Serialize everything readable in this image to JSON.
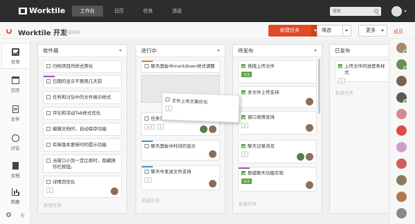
{
  "app": {
    "logo": "Worktile",
    "nav": [
      {
        "label": "工作台",
        "active": true
      },
      {
        "label": "日历",
        "active": false
      },
      {
        "label": "任务",
        "active": false
      },
      {
        "label": "消息",
        "active": false
      }
    ],
    "search": {
      "placeholder": "搜索"
    }
  },
  "project": {
    "title": "Worktile 开发",
    "subtitle": "喜成科技",
    "new_task": "新建任务",
    "filter": "筛选",
    "more": "更多",
    "members_label": "成员"
  },
  "sidebar": {
    "items": [
      {
        "label": "任务",
        "icon": "checkbox-icon",
        "active": true
      },
      {
        "label": "日历",
        "icon": "calendar-icon",
        "active": false
      },
      {
        "label": "文件",
        "icon": "file-icon",
        "active": false
      },
      {
        "label": "讨论",
        "icon": "discussion-icon",
        "active": false
      },
      {
        "label": "文档",
        "icon": "document-icon",
        "active": false
      },
      {
        "label": "简报",
        "icon": "report-icon",
        "active": false
      }
    ],
    "collapse": "折"
  },
  "lists": [
    {
      "title": "收件箱",
      "add_task": "新建任务",
      "cards": [
        {
          "title": "归档项目的样式美化",
          "done": false
        },
        {
          "title": "日期的显示不要用几天前",
          "done": false,
          "stripe": "#9b59b6"
        },
        {
          "title": "任务和讨论中的文件展示样式",
          "done": false
        },
        {
          "title": "评论和活动Tab样式优化",
          "done": false
        },
        {
          "title": "编辑文档时，自动保存功能",
          "done": false
        },
        {
          "title": "有新版本更新时的提示功能",
          "done": false
        },
        {
          "title": "当窗口小到一定比例时，隐藏操作栏按钮。",
          "done": false
        },
        {
          "title": "详情页优化",
          "done": false,
          "badges": [
            "1"
          ]
        }
      ]
    },
    {
      "title": "进行中",
      "add_task": "新建任务",
      "cards": [
        {
          "title": "聊天面板中markdown样式调整",
          "done": false,
          "stripe": "#e67e22"
        },
        {
          "title": "任务菜单中",
          "done": false,
          "badges": [
            "1/2",
            "1"
          ]
        },
        {
          "title": "聊天面板中时间的显示",
          "done": false,
          "stripe": "#3498db"
        },
        {
          "title": "聊天中发送文件支持",
          "done": false,
          "stripe": "#3498db",
          "badges": [
            "1"
          ]
        }
      ],
      "dragging": {
        "title": "文件上传文案优化",
        "badges": [
          "1"
        ]
      }
    },
    {
      "title": "待发布",
      "add_task": "新建任务",
      "cards": [
        {
          "title": "拖拽上传文件",
          "done": true,
          "badges": [
            "3/3"
          ]
        },
        {
          "title": "多文件上传支持",
          "done": true
        },
        {
          "title": "窗口表情支持",
          "done": true,
          "badges": [
            "2"
          ]
        },
        {
          "title": "聊天记录浏览",
          "done": true,
          "badges": [
            "1"
          ]
        },
        {
          "title": "群组聊天功能实现",
          "done": true,
          "badges": [
            "3/3"
          ]
        }
      ]
    },
    {
      "title": "已发布",
      "add_task": "新建任务",
      "cards": [
        {
          "title": "上传文件的进度条样式",
          "done": true,
          "badges": [
            "1"
          ]
        }
      ]
    }
  ],
  "members": [
    {
      "online": true
    },
    {
      "online": true
    },
    {
      "online": false
    },
    {
      "online": true
    },
    {
      "online": false
    },
    {
      "online": false
    },
    {
      "online": false
    },
    {
      "online": false
    },
    {
      "online": false
    },
    {
      "online": false
    },
    {
      "online": false
    }
  ]
}
